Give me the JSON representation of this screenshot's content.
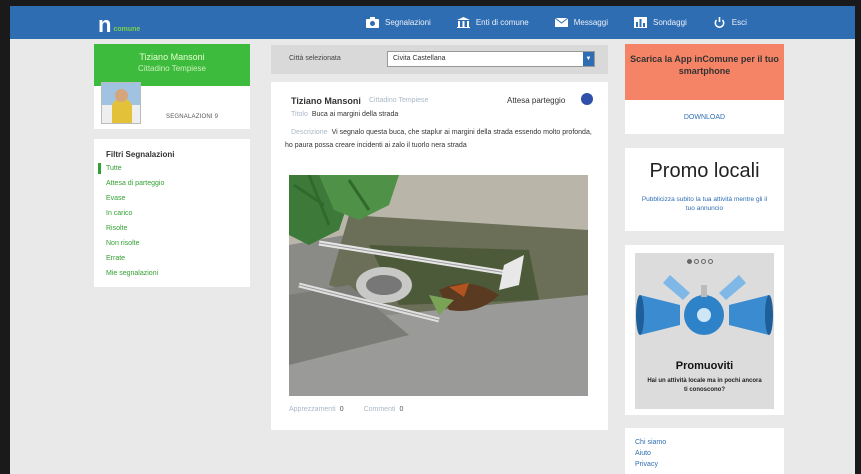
{
  "nav": {
    "logo_letter": "n",
    "logo_sub": "comune",
    "items": [
      {
        "label": "Segnalazioni",
        "icon": "camera-icon"
      },
      {
        "label": "Enti di comune",
        "icon": "building-icon"
      },
      {
        "label": "Messaggi",
        "icon": "envelope-icon"
      },
      {
        "label": "Sondaggi",
        "icon": "chart-icon"
      },
      {
        "label": "Esci",
        "icon": "power-icon"
      }
    ]
  },
  "profile": {
    "user": "Tiziano Mansoni",
    "city": "Cittadino Tempiese",
    "report_count": "SEGNALAZIONI 9"
  },
  "filters": {
    "title": "Filtri Segnalazioni",
    "items": [
      "Tutte",
      "Attesa di parteggio",
      "Evase",
      "In carico",
      "Risolte",
      "Non risolte",
      "Errate",
      "Mie segnalazioni"
    ]
  },
  "city_bar": {
    "label": "Città selezionata",
    "selected": "Civita Castellana"
  },
  "post": {
    "author": "Tiziano Mansoni",
    "author_city": "Cittadino Tempiese",
    "status": "Attesa parteggio",
    "title_key": "Titolo",
    "title": "Buca ai margini della strada",
    "desc_key": "Descrizione",
    "desc": "Vi segnalo questa buca, che staplur ai margini della strada essendo molto profonda, ho paura possa creare incidenti ai zalo il tuorlo nera strada",
    "likes_label": "Apprezzamenti",
    "likes": "0",
    "comments_label": "Commenti",
    "comments": "0"
  },
  "right": {
    "app_title": "Scarica la App inComune per il tuo smartphone",
    "download": "DOWNLOAD",
    "promo_title": "Promo locali",
    "promo_sub": "Pubblicizza subito la tua attività mentre gli il tuo annuncio",
    "banner_title": "Promuoviti",
    "banner_sub": "Hai un attività locale ma in pochi ancora ti conoscono?",
    "links": [
      "Chi siamo",
      "Aiuto",
      "Privacy"
    ]
  },
  "colors": {
    "nav": "#2f6db3",
    "green": "#3dbb3d",
    "salmon": "#f58466",
    "status_dot": "#2f4fa8"
  }
}
